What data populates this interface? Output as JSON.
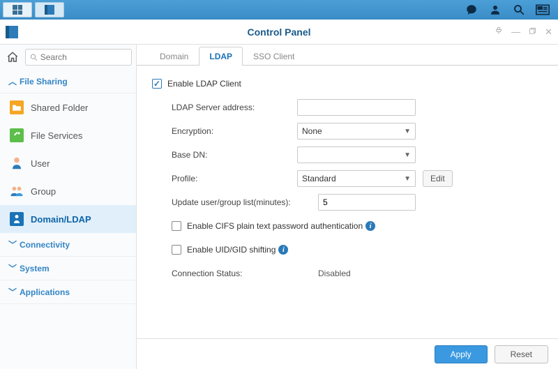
{
  "window": {
    "title": "Control Panel"
  },
  "search": {
    "placeholder": "Search"
  },
  "sidebar": {
    "sections": {
      "file_sharing": "File Sharing",
      "connectivity": "Connectivity",
      "system": "System",
      "applications": "Applications"
    },
    "items": {
      "shared_folder": "Shared Folder",
      "file_services": "File Services",
      "user": "User",
      "group": "Group",
      "domain_ldap": "Domain/LDAP"
    }
  },
  "tabs": {
    "domain": "Domain",
    "ldap": "LDAP",
    "sso": "SSO Client"
  },
  "ldap": {
    "enable_label": "Enable LDAP Client",
    "server_address_label": "LDAP Server address:",
    "server_address_value": "",
    "encryption_label": "Encryption:",
    "encryption_value": "None",
    "base_dn_label": "Base DN:",
    "base_dn_value": "",
    "profile_label": "Profile:",
    "profile_value": "Standard",
    "edit_label": "Edit",
    "update_interval_label": "Update user/group list(minutes):",
    "update_interval_value": "5",
    "cifs_label": "Enable CIFS plain text password authentication",
    "uid_gid_label": "Enable UID/GID shifting",
    "conn_status_label": "Connection Status:",
    "conn_status_value": "Disabled"
  },
  "footer": {
    "apply": "Apply",
    "reset": "Reset"
  }
}
